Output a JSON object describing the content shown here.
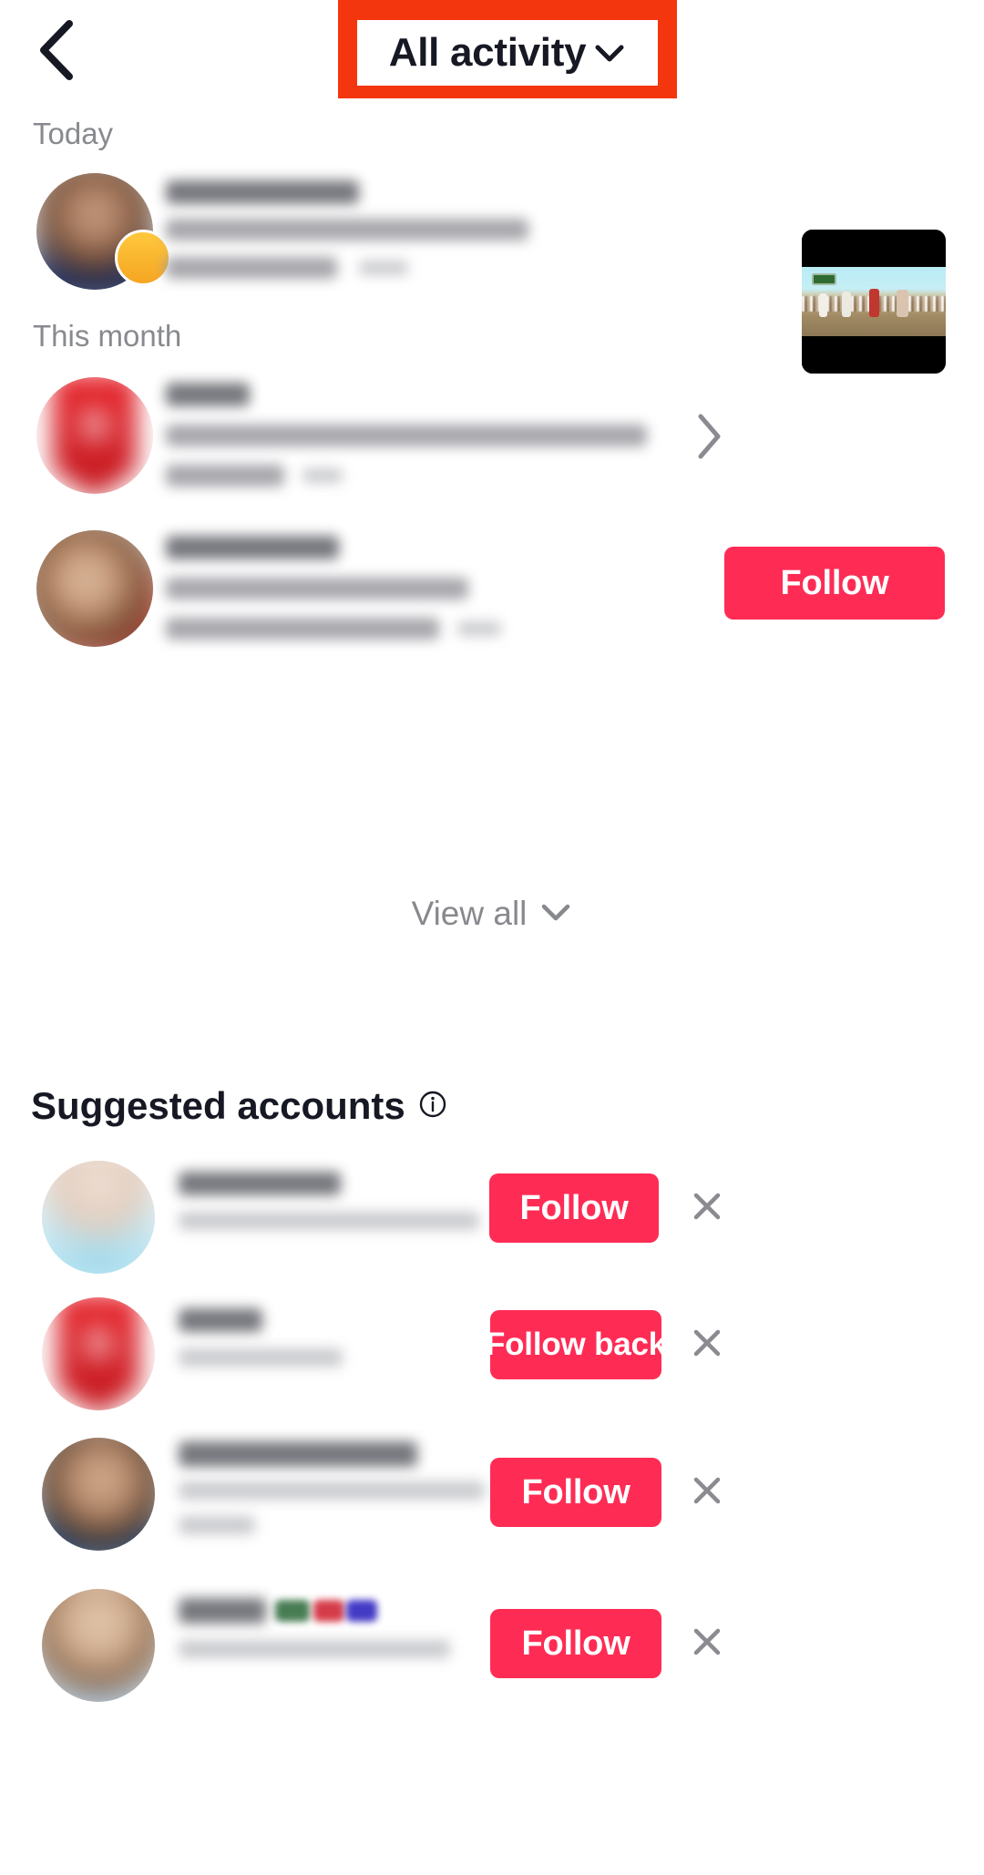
{
  "app": {
    "screen_name": "All activity",
    "platform_accent": "#fe2c55",
    "annotation_box_color": "#f4360f"
  },
  "header": {
    "back_icon": "chevron-left-icon",
    "title": "All activity",
    "title_caret_icon": "chevron-down-icon",
    "annotation_highlight": true
  },
  "sections": [
    {
      "label": "Today"
    },
    {
      "label": "This month"
    }
  ],
  "notifications": [
    {
      "id": "notif-mention",
      "section": "Today",
      "avatar_type": "person-with-badge",
      "name_redacted": true,
      "body_redacted": true,
      "has_thumbnail": true,
      "thumbnail_alt": "video-thumbnail"
    },
    {
      "id": "notif-follow-b",
      "section": "This month",
      "avatar_type": "b-logo",
      "avatar_letter": "B",
      "name_redacted": true,
      "body_redacted": true,
      "trailing_icon": "chevron-right-icon"
    },
    {
      "id": "notif-suggested-person",
      "section": "This month",
      "avatar_type": "person",
      "name_redacted": true,
      "body_redacted": true,
      "action_label": "Follow"
    }
  ],
  "view_all": {
    "label": "View all",
    "caret_icon": "chevron-down-icon"
  },
  "suggested": {
    "title": "Suggested accounts",
    "info_icon": "info-circle-icon",
    "accounts": [
      {
        "id": "sugg-1",
        "avatar_type": "princess",
        "name_redacted": true,
        "subtitle_redacted": true,
        "action_label": "Follow",
        "dismiss_icon": "close-icon"
      },
      {
        "id": "sugg-2",
        "avatar_type": "b-logo",
        "avatar_letter": "B",
        "name_redacted": true,
        "subtitle_redacted": true,
        "action_label": "Follow back",
        "dismiss_icon": "close-icon"
      },
      {
        "id": "sugg-3",
        "avatar_type": "person",
        "name_redacted": true,
        "subtitle_redacted": true,
        "action_label": "Follow",
        "dismiss_icon": "close-icon"
      },
      {
        "id": "sugg-4",
        "avatar_type": "person",
        "name_redacted": true,
        "subtitle_redacted": true,
        "action_label": "Follow",
        "dismiss_icon": "close-icon"
      }
    ]
  }
}
